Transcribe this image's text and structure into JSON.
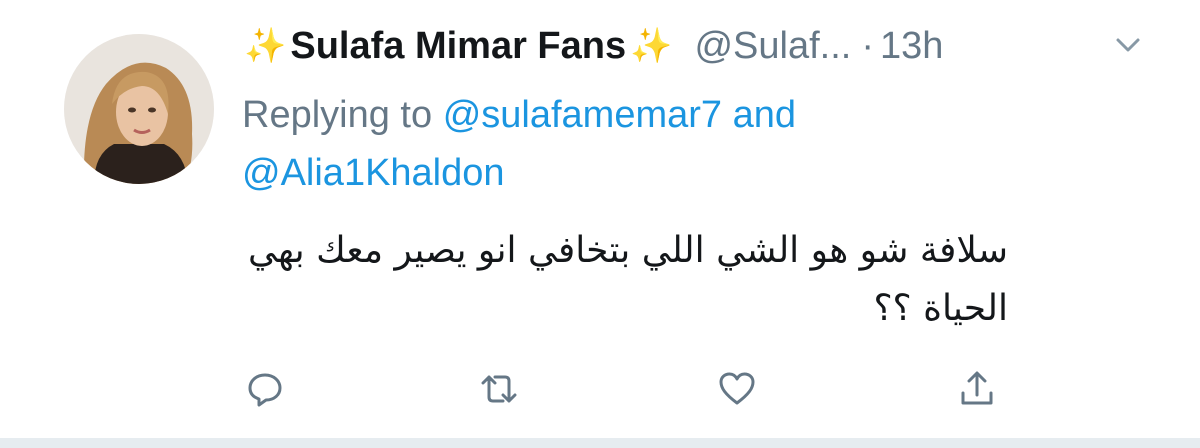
{
  "tweet": {
    "sparkle_left": "✨",
    "display_name": "Sulafa Mimar Fans",
    "sparkle_right": "✨",
    "handle": "@Sulaf...",
    "separator": "·",
    "time": "13h",
    "reply": {
      "prefix": "Replying to",
      "mention1": "@sulafamemar7",
      "and": "and",
      "mention2": "@Alia1Khaldon"
    },
    "text": "سلافة شو هو الشي اللي بتخافي انو يصير معك بهي الحياة ؟؟"
  },
  "icons": {
    "menu": "chevron-down-icon",
    "reply": "reply-icon",
    "retweet": "retweet-icon",
    "like": "heart-icon",
    "share": "share-icon"
  },
  "colors": {
    "text": "#14171a",
    "secondary": "#657786",
    "link": "#1b95e0",
    "sparkle": "#f2c230",
    "divider": "#e6ecf0"
  }
}
